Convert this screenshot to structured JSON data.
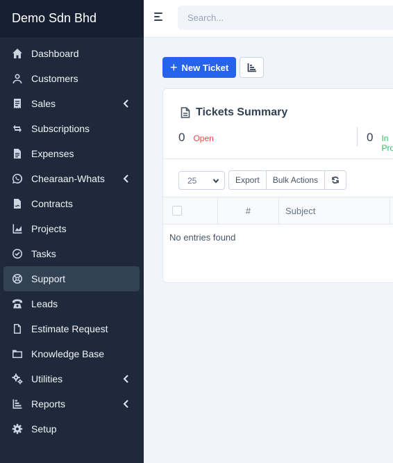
{
  "app": {
    "brand": "Demo Sdn Bhd"
  },
  "sidebar": {
    "items": [
      {
        "label": "Dashboard",
        "icon": "home-icon",
        "submenu": false,
        "active": false
      },
      {
        "label": "Customers",
        "icon": "user-icon",
        "submenu": false,
        "active": false
      },
      {
        "label": "Sales",
        "icon": "receipt-icon",
        "submenu": true,
        "active": false
      },
      {
        "label": "Subscriptions",
        "icon": "refresh-icon",
        "submenu": false,
        "active": false
      },
      {
        "label": "Expenses",
        "icon": "file-text-icon",
        "submenu": false,
        "active": false
      },
      {
        "label": "Chearaan-Whats",
        "icon": "whatsapp-icon",
        "submenu": true,
        "active": false
      },
      {
        "label": "Contracts",
        "icon": "contract-icon",
        "submenu": false,
        "active": false
      },
      {
        "label": "Projects",
        "icon": "chart-icon",
        "submenu": false,
        "active": false
      },
      {
        "label": "Tasks",
        "icon": "check-circle-icon",
        "submenu": false,
        "active": false
      },
      {
        "label": "Support",
        "icon": "lifebuoy-icon",
        "submenu": false,
        "active": true
      },
      {
        "label": "Leads",
        "icon": "phone-icon",
        "submenu": false,
        "active": false
      },
      {
        "label": "Estimate Request",
        "icon": "document-icon",
        "submenu": false,
        "active": false
      },
      {
        "label": "Knowledge Base",
        "icon": "folder-icon",
        "submenu": false,
        "active": false
      },
      {
        "label": "Utilities",
        "icon": "cogs-icon",
        "submenu": true,
        "active": false
      },
      {
        "label": "Reports",
        "icon": "bar-chart-icon",
        "submenu": true,
        "active": false
      },
      {
        "label": "Setup",
        "icon": "gear-icon",
        "submenu": false,
        "active": false
      }
    ]
  },
  "topbar": {
    "search_placeholder": "Search..."
  },
  "toolbar": {
    "new_ticket_label": "New Ticket"
  },
  "summary": {
    "title": "Tickets Summary",
    "stats": [
      {
        "count": "0",
        "label": "Open",
        "color": "#ef4444"
      },
      {
        "count": "0",
        "label": "In Progress",
        "color": "#22c55e"
      }
    ]
  },
  "table": {
    "page_size": "25",
    "export_label": "Export",
    "bulk_actions_label": "Bulk Actions",
    "columns": [
      "#",
      "Subject"
    ],
    "empty_message": "No entries found"
  },
  "colors": {
    "sidebar_bg": "#1e293b",
    "primary": "#2563eb",
    "open": "#ef4444",
    "in_progress": "#22c55e"
  }
}
